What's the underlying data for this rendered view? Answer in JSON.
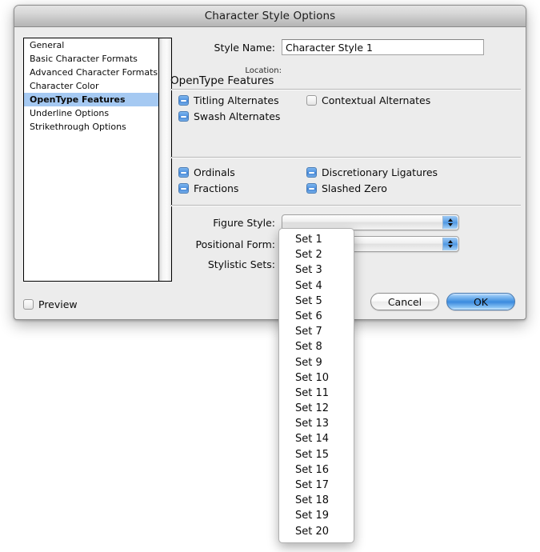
{
  "window": {
    "title": "Character Style Options"
  },
  "sidebar": {
    "items": [
      {
        "label": "General",
        "selected": false
      },
      {
        "label": "Basic Character Formats",
        "selected": false
      },
      {
        "label": "Advanced Character Formats",
        "selected": false
      },
      {
        "label": "Character Color",
        "selected": false
      },
      {
        "label": "OpenType Features",
        "selected": true
      },
      {
        "label": "Underline Options",
        "selected": false
      },
      {
        "label": "Strikethrough Options",
        "selected": false
      }
    ]
  },
  "style_name": {
    "label": "Style Name:",
    "value": "Character Style 1",
    "placeholder": ""
  },
  "location": {
    "label": "Location:",
    "value": ""
  },
  "section": {
    "title": "OpenType Features"
  },
  "checkboxes": [
    {
      "label": "Titling Alternates",
      "state": "mixed"
    },
    {
      "label": "Contextual Alternates",
      "state": "off"
    },
    {
      "label": "Swash Alternates",
      "state": "mixed"
    },
    {
      "label": "Ordinals",
      "state": "mixed"
    },
    {
      "label": "Discretionary Ligatures",
      "state": "mixed"
    },
    {
      "label": "Fractions",
      "state": "mixed"
    },
    {
      "label": "Slashed Zero",
      "state": "mixed"
    }
  ],
  "selects": {
    "figure_style": {
      "label": "Figure Style:",
      "value": ""
    },
    "positional_form": {
      "label": "Positional Form:",
      "value": ""
    },
    "stylistic_sets": {
      "label": "Stylistic Sets:",
      "value": ""
    }
  },
  "stylistic_sets_menu": {
    "items": [
      "Set 1",
      "Set 2",
      "Set 3",
      "Set 4",
      "Set 5",
      "Set 6",
      "Set 7",
      "Set 8",
      "Set 9",
      "Set 10",
      "Set 11",
      "Set 12",
      "Set 13",
      "Set 14",
      "Set 15",
      "Set 16",
      "Set 17",
      "Set 18",
      "Set 19",
      "Set 20"
    ]
  },
  "preview": {
    "label": "Preview",
    "state": "off"
  },
  "buttons": {
    "cancel": "Cancel",
    "ok": "OK"
  },
  "colors": {
    "accent": "#3f8fe0",
    "selection": "#a5c9f2",
    "dialog_bg": "#ececec",
    "text": "#0b0b0b"
  }
}
